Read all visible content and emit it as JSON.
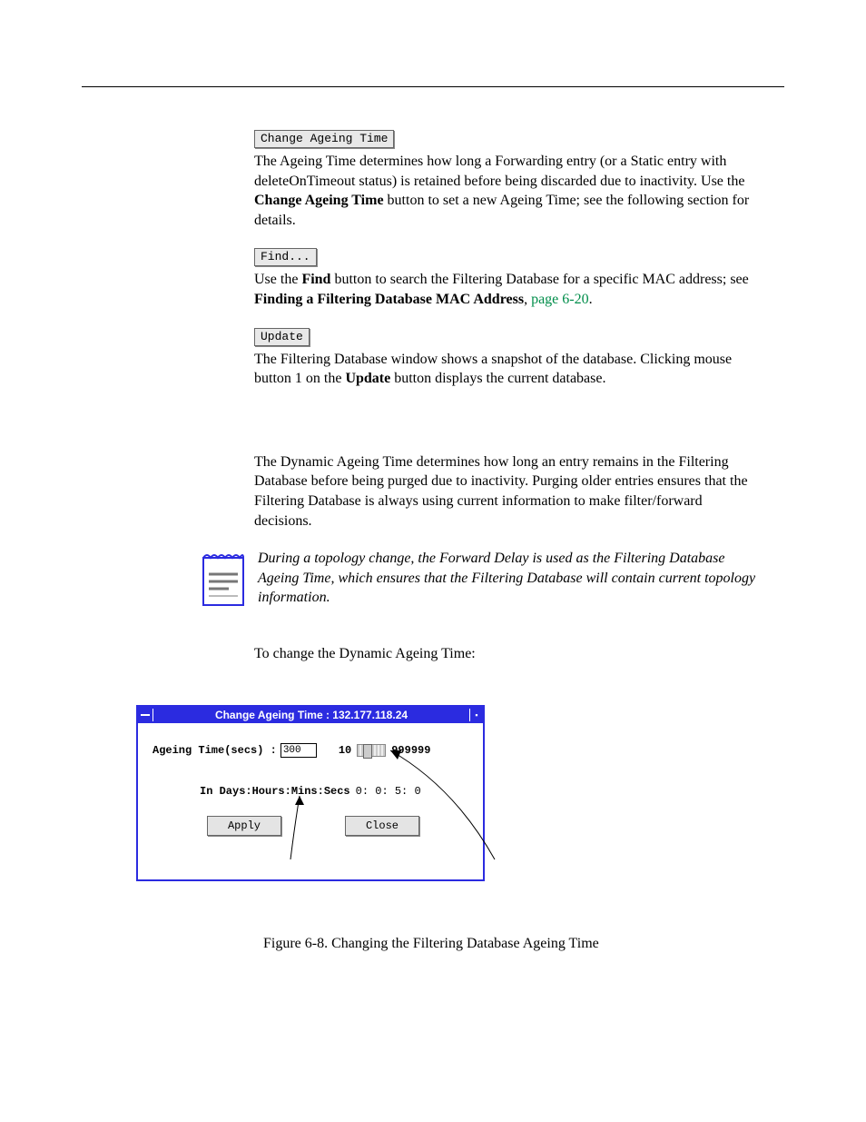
{
  "buttons": {
    "change_ageing": "Change Ageing Time",
    "find": "Find...",
    "update": "Update"
  },
  "change_ageing_para": {
    "t1": "The Ageing Time determines how long a Forwarding entry (or a Static entry with deleteOnTimeout status) is retained before being discarded due to inactivity. Use the ",
    "bold": "Change Ageing Time",
    "t2": " button to set a new Ageing Time; see the following section for details."
  },
  "find_para": {
    "t1": "Use the ",
    "bold1": "Find",
    "t2": " button to search the Filtering Database for a specific MAC address; see ",
    "bold2": "Finding a Filtering Database MAC Address",
    "t3": ", ",
    "link": "page 6-20",
    "t4": "."
  },
  "update_para": {
    "t1": "The Filtering Database window shows a snapshot of the database. Clicking mouse button 1 on the ",
    "bold": "Update",
    "t2": " button displays the current database."
  },
  "dynamic_para": "The Dynamic Ageing Time determines how long an entry remains in the Filtering Database before being purged due to inactivity. Purging older entries ensures that the Filtering Database is always using current information to make filter/forward decisions.",
  "note_text": "During a topology change, the Forward Delay is used as the Filtering Database Ageing Time, which ensures that the Filtering Database will contain current topology information.",
  "to_change": "To change the Dynamic Ageing Time:",
  "dialog": {
    "title": "Change Ageing Time : 132.177.118.24",
    "label": "Ageing Time(secs) :",
    "value": "300",
    "min": "10",
    "max": "999999",
    "line2_label": "In Days:Hours:Mins:Secs",
    "line2_value": "0: 0: 5: 0",
    "apply": "Apply",
    "close": "Close"
  },
  "figure_caption": "Figure 6-8. Changing the Filtering Database Ageing Time"
}
